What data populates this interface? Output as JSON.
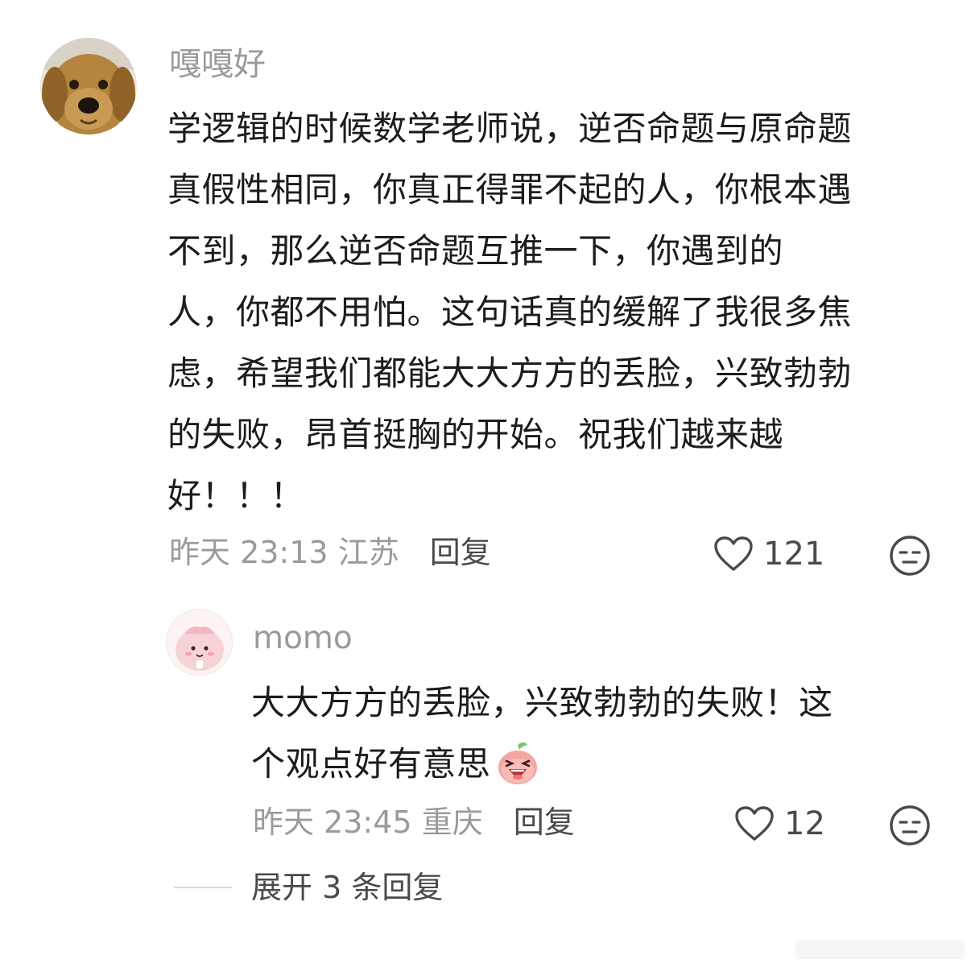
{
  "comment": {
    "username": "嘎嘎好",
    "lines": [
      "学逻辑的时候数学老师说，逆否命题与原命题",
      "真假性相同，你真正得罪不起的人，你根本遇",
      "不到，那么逆否命题互推一下，你遇到的",
      "人，你都不用怕。这句话真的缓解了我很多焦",
      "虑，希望我们都能大大方方的丢脸，兴致勃勃",
      "的失败，昂首挺胸的开始。祝我们越来越",
      "好！！！"
    ],
    "time": "昨天 23:13",
    "location": "江苏",
    "reply_label": "回复",
    "likes": "121",
    "avatar_icon": "dog-avatar",
    "like_icon": "heart-outline-icon",
    "face_icon": "neutral-face-icon"
  },
  "reply": {
    "username": "momo",
    "lines": [
      "大大方方的丢脸，兴致勃勃的失败！这",
      "个观点好有意思"
    ],
    "emoji": "laughing-peach-emoji",
    "time": "昨天 23:45",
    "location": "重庆",
    "reply_label": "回复",
    "likes": "12",
    "avatar_icon": "pink-cartoon-avatar"
  },
  "expand": {
    "label": "展开 3 条回复"
  },
  "colors": {
    "text": "#1c1c1c",
    "muted": "#9a9a9a",
    "action": "#4a4a4a"
  }
}
